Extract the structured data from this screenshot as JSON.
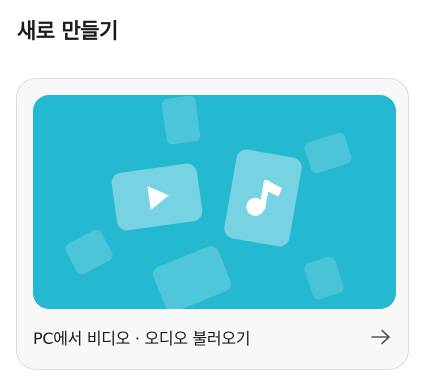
{
  "section": {
    "title": "새로 만들기"
  },
  "card": {
    "label": "PC에서 비디오 · 오디오 불러오기",
    "icon": "arrow-right-icon",
    "illustration": {
      "video_icon": "video-file-icon",
      "audio_icon": "audio-file-icon"
    }
  },
  "colors": {
    "banner_bg": "#25b8d1",
    "card_bg": "#f8f8f8",
    "tile_light": "#ffffff"
  }
}
